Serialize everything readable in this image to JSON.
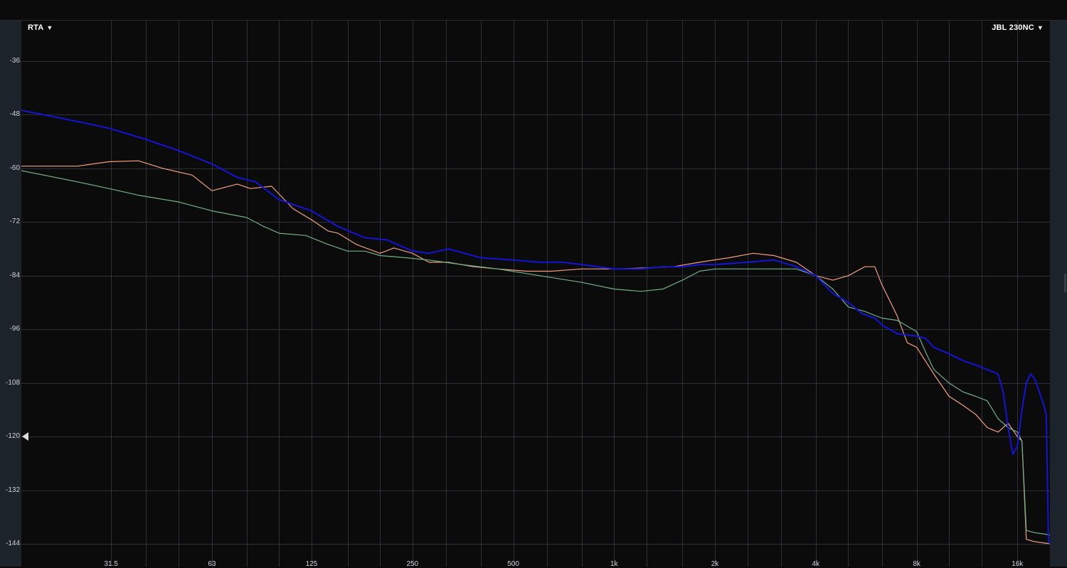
{
  "header": {
    "mode_label": "RTA",
    "device_label": "JBL 230NC",
    "caret": "▼"
  },
  "colors": {
    "background": "#0b0b0c",
    "grid": "#2e3135",
    "gutter": "#1d232a",
    "series_orange": "#f4a07a",
    "series_green": "#6fb088",
    "series_blue": "#1414d8"
  },
  "chart_data": {
    "type": "line",
    "x_scale": "log",
    "xlim": [
      17,
      20000
    ],
    "ylim": [
      -144,
      -36
    ],
    "yticks": [
      -36,
      -48,
      -60,
      -72,
      -84,
      -96,
      -108,
      -120,
      -132,
      -144
    ],
    "xticks": [
      {
        "label": "31.5",
        "value": 31.5
      },
      {
        "label": "63",
        "value": 63
      },
      {
        "label": "125",
        "value": 125
      },
      {
        "label": "250",
        "value": 250
      },
      {
        "label": "500",
        "value": 500
      },
      {
        "label": "1k",
        "value": 1000
      },
      {
        "label": "2k",
        "value": 2000
      },
      {
        "label": "4k",
        "value": 4000
      },
      {
        "label": "8k",
        "value": 8000
      },
      {
        "label": "16k",
        "value": 16000
      }
    ],
    "minor_gridlines": [
      40,
      50,
      80,
      100,
      160,
      200,
      315,
      400,
      630,
      800,
      1250,
      1600,
      2500,
      3150,
      5000,
      6300,
      10000,
      12500
    ],
    "grid": true,
    "level_handle": -120,
    "series": [
      {
        "color": "#f4a07a",
        "points": [
          [
            17,
            -59.5
          ],
          [
            25,
            -59.5
          ],
          [
            31,
            -58.5
          ],
          [
            38,
            -58.3
          ],
          [
            45,
            -60
          ],
          [
            55,
            -61.5
          ],
          [
            63,
            -65
          ],
          [
            75,
            -63.5
          ],
          [
            82,
            -64.5
          ],
          [
            95,
            -64
          ],
          [
            110,
            -69
          ],
          [
            125,
            -71.5
          ],
          [
            140,
            -74
          ],
          [
            150,
            -74.5
          ],
          [
            170,
            -77
          ],
          [
            200,
            -79
          ],
          [
            220,
            -77.8
          ],
          [
            250,
            -79
          ],
          [
            280,
            -81
          ],
          [
            320,
            -81
          ],
          [
            380,
            -82
          ],
          [
            450,
            -82.5
          ],
          [
            550,
            -83
          ],
          [
            650,
            -83
          ],
          [
            800,
            -82.5
          ],
          [
            1000,
            -82.5
          ],
          [
            1200,
            -82.3
          ],
          [
            1500,
            -82
          ],
          [
            1800,
            -81
          ],
          [
            2200,
            -80
          ],
          [
            2600,
            -79
          ],
          [
            3000,
            -79.5
          ],
          [
            3500,
            -81
          ],
          [
            4000,
            -84
          ],
          [
            4500,
            -85
          ],
          [
            5000,
            -84
          ],
          [
            5600,
            -82
          ],
          [
            6000,
            -82
          ],
          [
            6300,
            -86
          ],
          [
            7000,
            -93
          ],
          [
            7500,
            -99
          ],
          [
            8000,
            -100
          ],
          [
            9000,
            -106
          ],
          [
            10000,
            -111
          ],
          [
            11000,
            -113
          ],
          [
            12000,
            -115
          ],
          [
            13000,
            -118
          ],
          [
            14000,
            -119
          ],
          [
            15000,
            -117
          ],
          [
            16000,
            -120
          ],
          [
            16500,
            -121
          ],
          [
            17000,
            -143
          ],
          [
            18000,
            -143.5
          ],
          [
            20000,
            -144
          ]
        ]
      },
      {
        "color": "#6fb088",
        "points": [
          [
            17,
            -60.5
          ],
          [
            25,
            -63
          ],
          [
            31,
            -64.5
          ],
          [
            38,
            -66
          ],
          [
            50,
            -67.5
          ],
          [
            63,
            -69.5
          ],
          [
            80,
            -71
          ],
          [
            90,
            -73
          ],
          [
            100,
            -74.5
          ],
          [
            120,
            -75
          ],
          [
            140,
            -77
          ],
          [
            160,
            -78.5
          ],
          [
            180,
            -78.5
          ],
          [
            200,
            -79.5
          ],
          [
            240,
            -80
          ],
          [
            280,
            -80.5
          ],
          [
            350,
            -81.5
          ],
          [
            450,
            -82.5
          ],
          [
            600,
            -84
          ],
          [
            800,
            -85.5
          ],
          [
            1000,
            -87
          ],
          [
            1200,
            -87.5
          ],
          [
            1400,
            -87
          ],
          [
            1600,
            -85
          ],
          [
            1800,
            -83
          ],
          [
            2000,
            -82.5
          ],
          [
            2500,
            -82.5
          ],
          [
            3000,
            -82.5
          ],
          [
            3500,
            -82.5
          ],
          [
            4000,
            -84
          ],
          [
            4500,
            -87
          ],
          [
            5000,
            -91
          ],
          [
            5600,
            -92
          ],
          [
            6300,
            -93.5
          ],
          [
            7000,
            -94
          ],
          [
            8000,
            -96.5
          ],
          [
            8500,
            -101
          ],
          [
            9000,
            -105
          ],
          [
            10000,
            -108
          ],
          [
            11000,
            -110
          ],
          [
            12000,
            -111
          ],
          [
            13000,
            -112
          ],
          [
            14000,
            -116
          ],
          [
            15000,
            -118
          ],
          [
            16000,
            -119
          ],
          [
            16500,
            -121
          ],
          [
            17000,
            -141
          ],
          [
            18000,
            -141.5
          ],
          [
            20000,
            -142
          ]
        ]
      },
      {
        "color": "#1414d8",
        "points": [
          [
            17,
            -47
          ],
          [
            25,
            -49.5
          ],
          [
            31,
            -51
          ],
          [
            40,
            -53.5
          ],
          [
            50,
            -56
          ],
          [
            63,
            -59
          ],
          [
            75,
            -62
          ],
          [
            85,
            -63
          ],
          [
            100,
            -67
          ],
          [
            125,
            -69.5
          ],
          [
            150,
            -73
          ],
          [
            180,
            -75.5
          ],
          [
            210,
            -76
          ],
          [
            250,
            -78.5
          ],
          [
            280,
            -79
          ],
          [
            320,
            -78
          ],
          [
            400,
            -80
          ],
          [
            500,
            -80.5
          ],
          [
            600,
            -81
          ],
          [
            700,
            -81
          ],
          [
            800,
            -81.5
          ],
          [
            1000,
            -82.5
          ],
          [
            1200,
            -82.5
          ],
          [
            1400,
            -82
          ],
          [
            1600,
            -82
          ],
          [
            1800,
            -81.5
          ],
          [
            2000,
            -81.5
          ],
          [
            2500,
            -81
          ],
          [
            3000,
            -80.5
          ],
          [
            3500,
            -82
          ],
          [
            4000,
            -84
          ],
          [
            4500,
            -88
          ],
          [
            5000,
            -90
          ],
          [
            5500,
            -92.5
          ],
          [
            6000,
            -93.5
          ],
          [
            6300,
            -95
          ],
          [
            7000,
            -97
          ],
          [
            8000,
            -97.5
          ],
          [
            8500,
            -98
          ],
          [
            9000,
            -100
          ],
          [
            10000,
            -101.5
          ],
          [
            11000,
            -103
          ],
          [
            12000,
            -104
          ],
          [
            13000,
            -105
          ],
          [
            14000,
            -106
          ],
          [
            14500,
            -110
          ],
          [
            15000,
            -118
          ],
          [
            15500,
            -124
          ],
          [
            16000,
            -122
          ],
          [
            16500,
            -114
          ],
          [
            17000,
            -108
          ],
          [
            17500,
            -106
          ],
          [
            18000,
            -107
          ],
          [
            19000,
            -112
          ],
          [
            19500,
            -115
          ],
          [
            19800,
            -143
          ],
          [
            20000,
            -144
          ]
        ]
      }
    ]
  }
}
